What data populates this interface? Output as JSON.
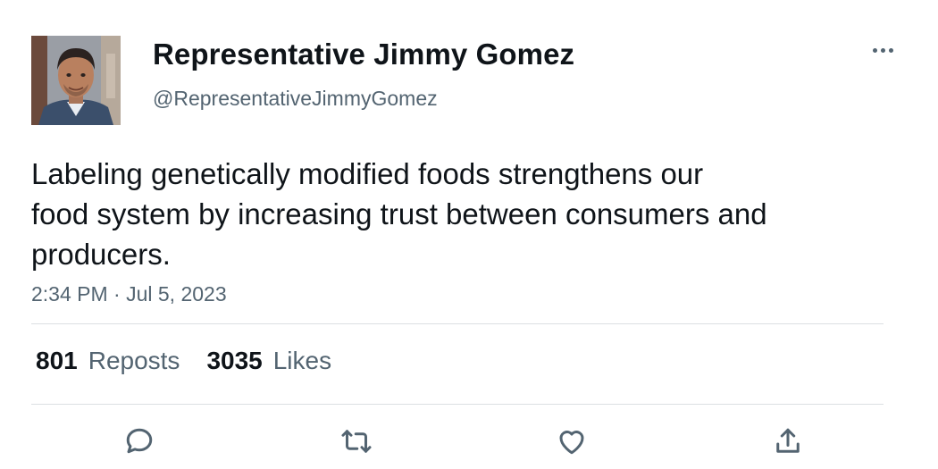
{
  "author": {
    "display_name": "Representative Jimmy Gomez",
    "handle": "@RepresentativeJimmyGomez",
    "avatar_icon": "profile-photo"
  },
  "tweet": {
    "text_lines": [
      "Labeling genetically modified foods strengthens our",
      "food system by increasing trust between consumers and",
      "producers."
    ],
    "timestamp": "2:34 PM · Jul 5, 2023"
  },
  "stats": {
    "reposts_count": "801",
    "reposts_label": "Reposts",
    "likes_count": "3035",
    "likes_label": "Likes"
  },
  "actions": {
    "icons": [
      "reply-icon",
      "repost-icon",
      "like-icon",
      "share-icon"
    ]
  },
  "colors": {
    "text": "#0f1419",
    "secondary": "#536471",
    "divider": "#dcdfe2"
  }
}
